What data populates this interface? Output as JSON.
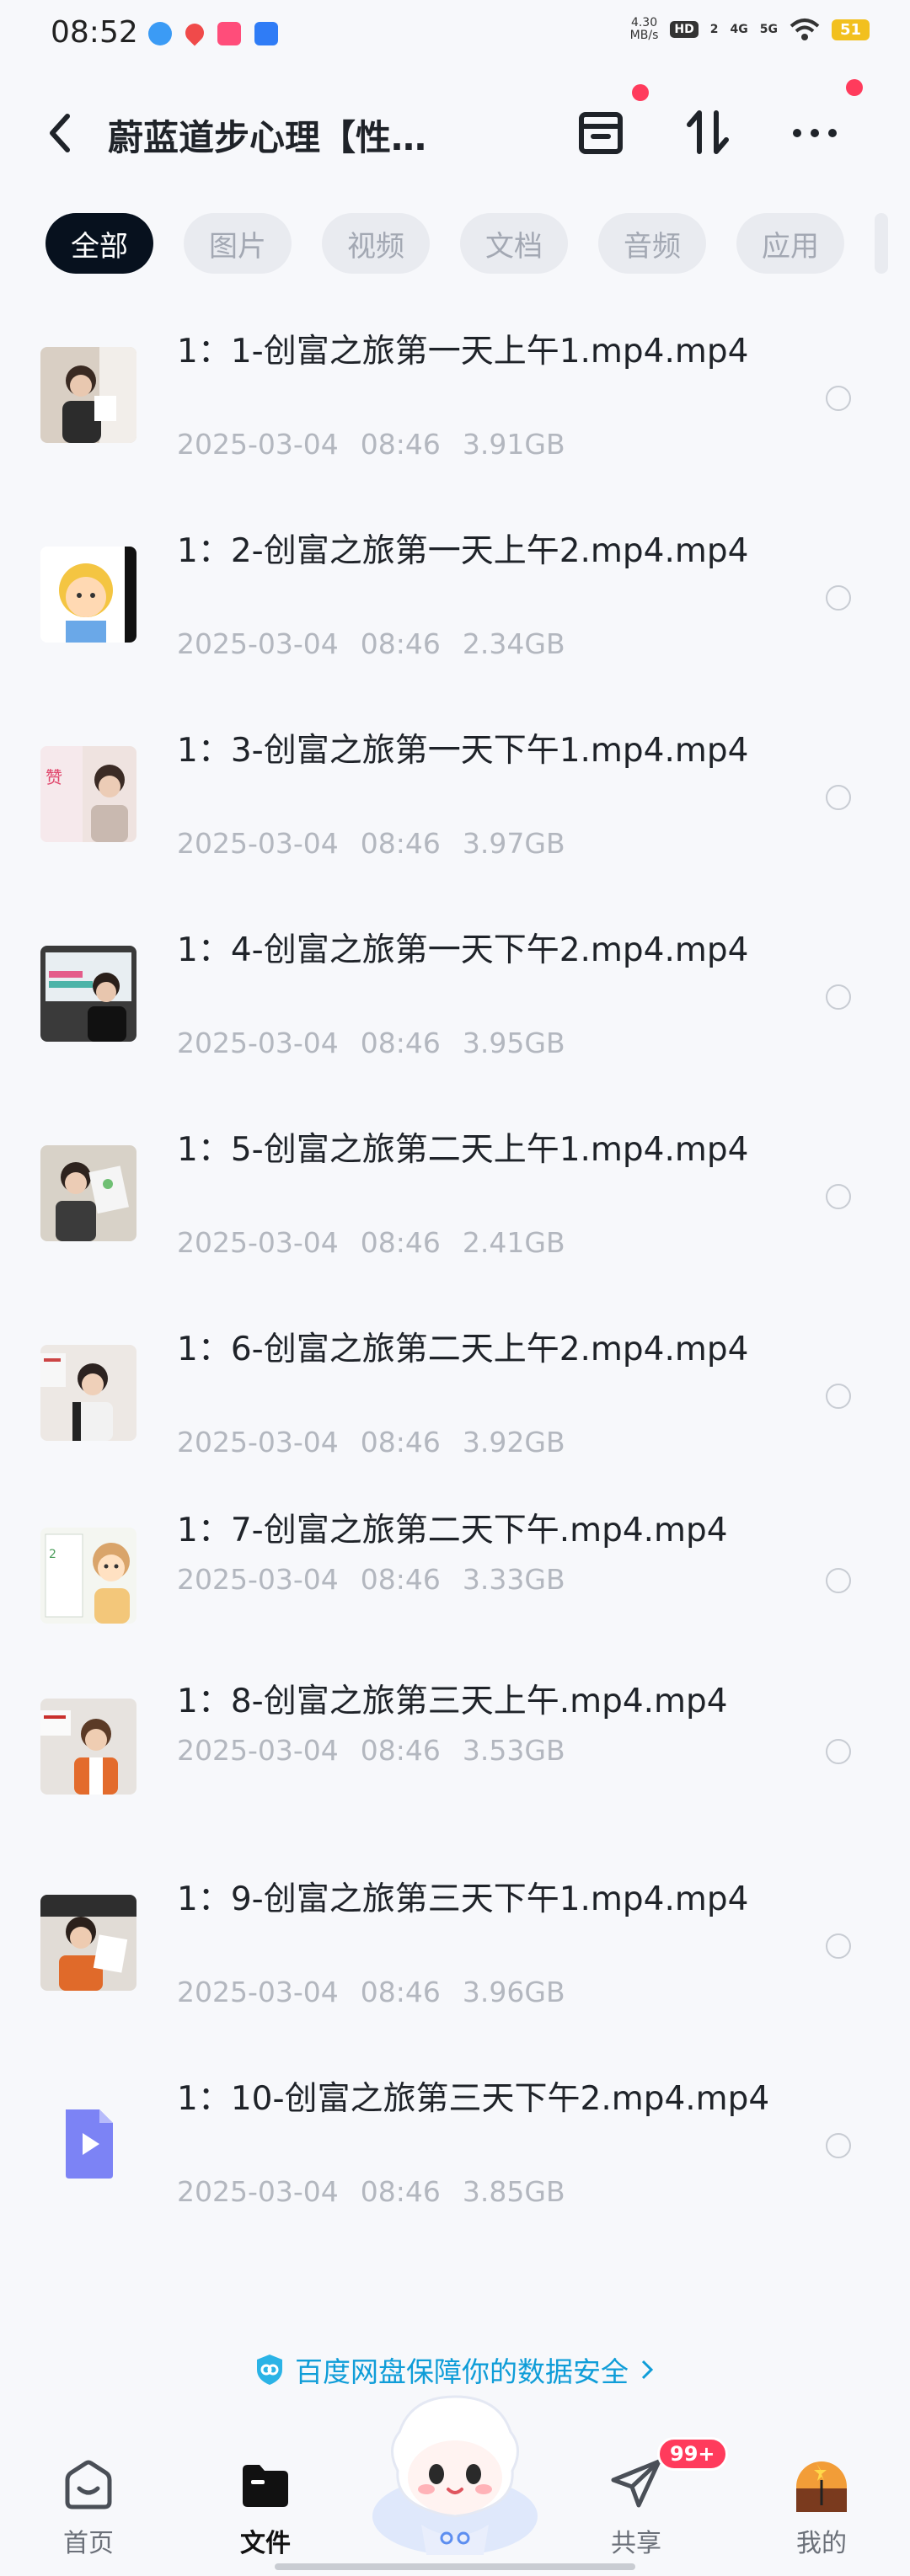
{
  "status": {
    "time": "08:52",
    "net_speed_value": "4.30",
    "net_speed_unit": "MB/s",
    "hd": "HD",
    "hd_num": "2",
    "sig1": "4G",
    "sig2": "5G",
    "battery": "51"
  },
  "nav": {
    "title": "蔚蓝道步心理【性…"
  },
  "tabs": [
    {
      "label": "全部"
    },
    {
      "label": "图片"
    },
    {
      "label": "视频"
    },
    {
      "label": "文档"
    },
    {
      "label": "音频"
    },
    {
      "label": "应用"
    }
  ],
  "files": [
    {
      "name": "1：1-创富之旅第一天上午1.mp4.mp4",
      "date": "2025-03-04",
      "time": "08:46",
      "size": "3.91GB"
    },
    {
      "name": "1：2-创富之旅第一天上午2.mp4.mp4",
      "date": "2025-03-04",
      "time": "08:46",
      "size": "2.34GB"
    },
    {
      "name": "1：3-创富之旅第一天下午1.mp4.mp4",
      "date": "2025-03-04",
      "time": "08:46",
      "size": "3.97GB"
    },
    {
      "name": "1：4-创富之旅第一天下午2.mp4.mp4",
      "date": "2025-03-04",
      "time": "08:46",
      "size": "3.95GB"
    },
    {
      "name": "1：5-创富之旅第二天上午1.mp4.mp4",
      "date": "2025-03-04",
      "time": "08:46",
      "size": "2.41GB"
    },
    {
      "name": "1：6-创富之旅第二天上午2.mp4.mp4",
      "date": "2025-03-04",
      "time": "08:46",
      "size": "3.92GB"
    },
    {
      "name": "1：7-创富之旅第二天下午.mp4.mp4",
      "date": "2025-03-04",
      "time": "08:46",
      "size": "3.33GB"
    },
    {
      "name": "1：8-创富之旅第三天上午.mp4.mp4",
      "date": "2025-03-04",
      "time": "08:46",
      "size": "3.53GB"
    },
    {
      "name": "1：9-创富之旅第三天下午1.mp4.mp4",
      "date": "2025-03-04",
      "time": "08:46",
      "size": "3.96GB"
    },
    {
      "name": "1：10-创富之旅第三天下午2.mp4.mp4",
      "date": "2025-03-04",
      "time": "08:46",
      "size": "3.85GB"
    }
  ],
  "safety_notice": "百度网盘保障你的数据安全",
  "bottom_nav": {
    "home": "首页",
    "files": "文件",
    "share": "共享",
    "mine": "我的",
    "share_badge": "99+"
  },
  "colors": {
    "accent": "#0f9dd8",
    "badge": "#ff3b5c",
    "active_tab": "#07111e"
  }
}
